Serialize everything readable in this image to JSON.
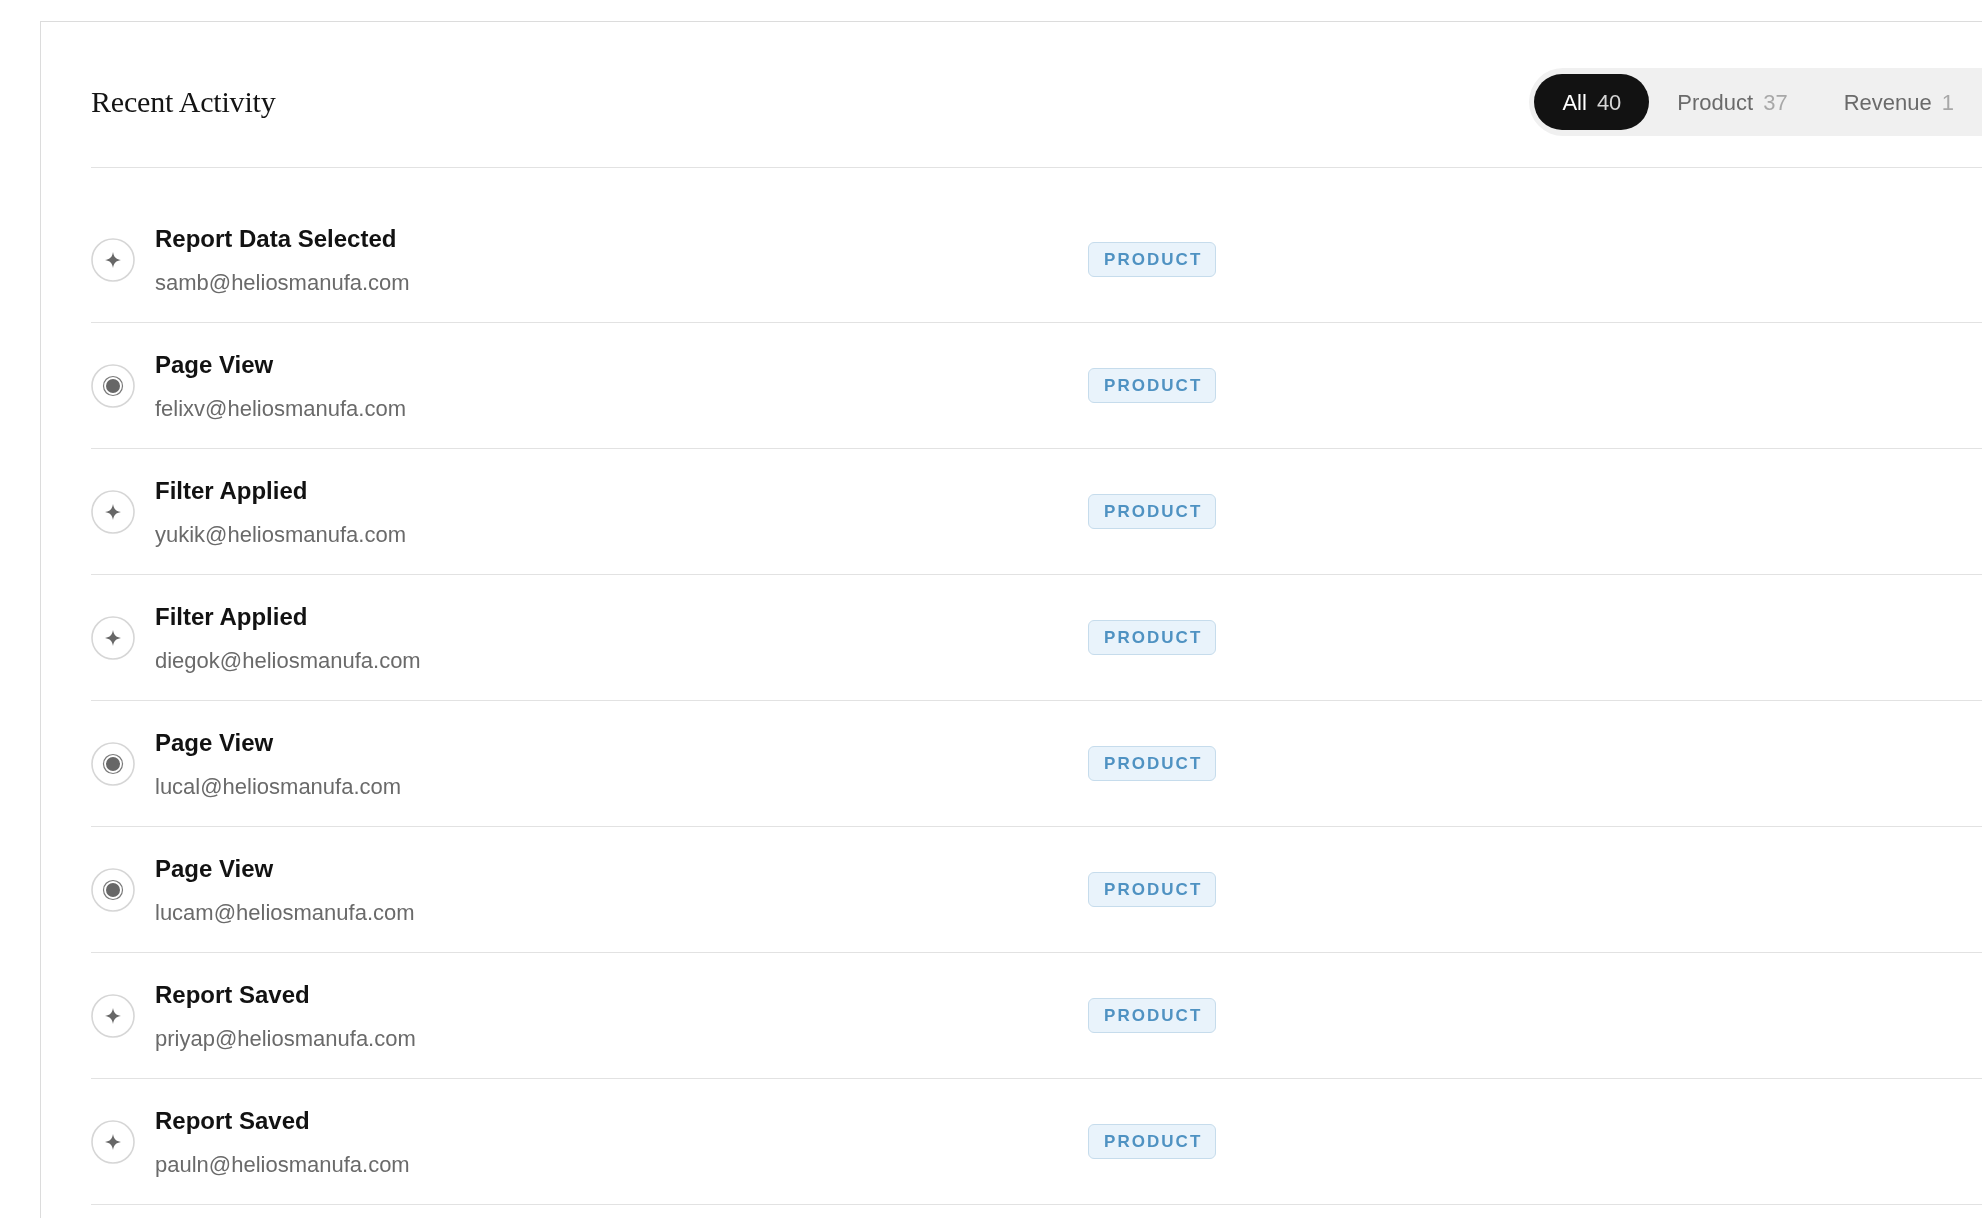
{
  "panel": {
    "title": "Recent Activity"
  },
  "filter_tabs": [
    {
      "label": "All",
      "count": "40",
      "selected": true
    },
    {
      "label": "Product",
      "count": "37",
      "selected": false
    },
    {
      "label": "Revenue",
      "count": "1",
      "selected": false
    }
  ],
  "activities": [
    {
      "kind": "sparkle",
      "title": "Report Data Selected",
      "email": "samb@heliosmanufa.com",
      "tag": "PRODUCT"
    },
    {
      "kind": "dot",
      "title": "Page View",
      "email": "felixv@heliosmanufa.com",
      "tag": "PRODUCT"
    },
    {
      "kind": "sparkle",
      "title": "Filter Applied",
      "email": "yukik@heliosmanufa.com",
      "tag": "PRODUCT"
    },
    {
      "kind": "sparkle",
      "title": "Filter Applied",
      "email": "diegok@heliosmanufa.com",
      "tag": "PRODUCT"
    },
    {
      "kind": "dot",
      "title": "Page View",
      "email": "lucal@heliosmanufa.com",
      "tag": "PRODUCT"
    },
    {
      "kind": "dot",
      "title": "Page View",
      "email": "lucam@heliosmanufa.com",
      "tag": "PRODUCT"
    },
    {
      "kind": "sparkle",
      "title": "Report Saved",
      "email": "priyap@heliosmanufa.com",
      "tag": "PRODUCT"
    },
    {
      "kind": "sparkle",
      "title": "Report Saved",
      "email": "pauln@heliosmanufa.com",
      "tag": "PRODUCT"
    }
  ]
}
